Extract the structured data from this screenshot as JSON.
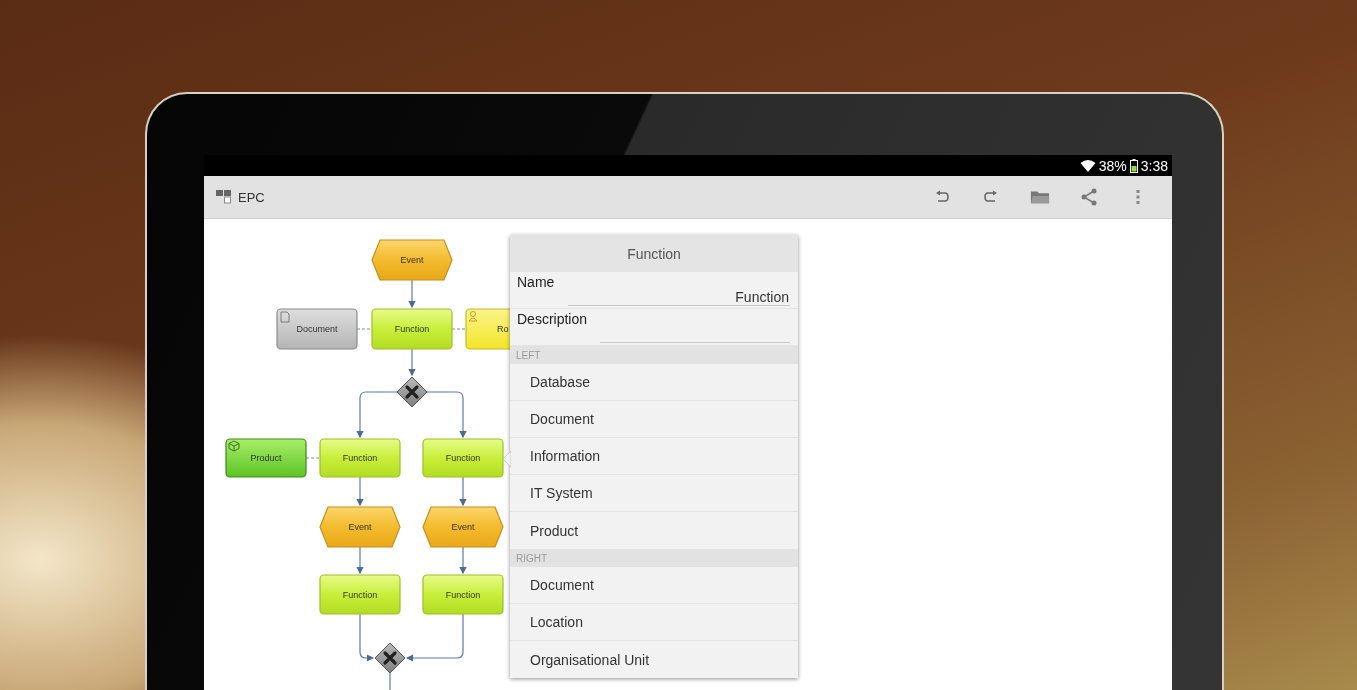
{
  "status_bar": {
    "battery": "38%",
    "time": "3:38"
  },
  "app_bar": {
    "title": "EPC"
  },
  "diagram": {
    "nodes": [
      {
        "kind": "event",
        "label": "Event"
      },
      {
        "kind": "document",
        "label": "Document"
      },
      {
        "kind": "function",
        "label": "Function"
      },
      {
        "kind": "role",
        "label": "Ro"
      },
      {
        "kind": "gateway"
      },
      {
        "kind": "product",
        "label": "Product"
      },
      {
        "kind": "function",
        "label": "Function"
      },
      {
        "kind": "function",
        "label": "Function"
      },
      {
        "kind": "event",
        "label": "Event"
      },
      {
        "kind": "event",
        "label": "Event"
      },
      {
        "kind": "function",
        "label": "Function"
      },
      {
        "kind": "function",
        "label": "Function"
      },
      {
        "kind": "gateway"
      }
    ]
  },
  "popup": {
    "title": "Function",
    "fields": [
      {
        "label": "Name",
        "value": "Function"
      },
      {
        "label": "Description"
      }
    ],
    "sections": [
      {
        "header": "LEFT",
        "items": [
          "Database",
          "Document",
          "Information",
          "IT System",
          "Product"
        ]
      },
      {
        "header": "RIGHT",
        "items": [
          "Document",
          "Location",
          "Organisational Unit"
        ]
      }
    ]
  }
}
